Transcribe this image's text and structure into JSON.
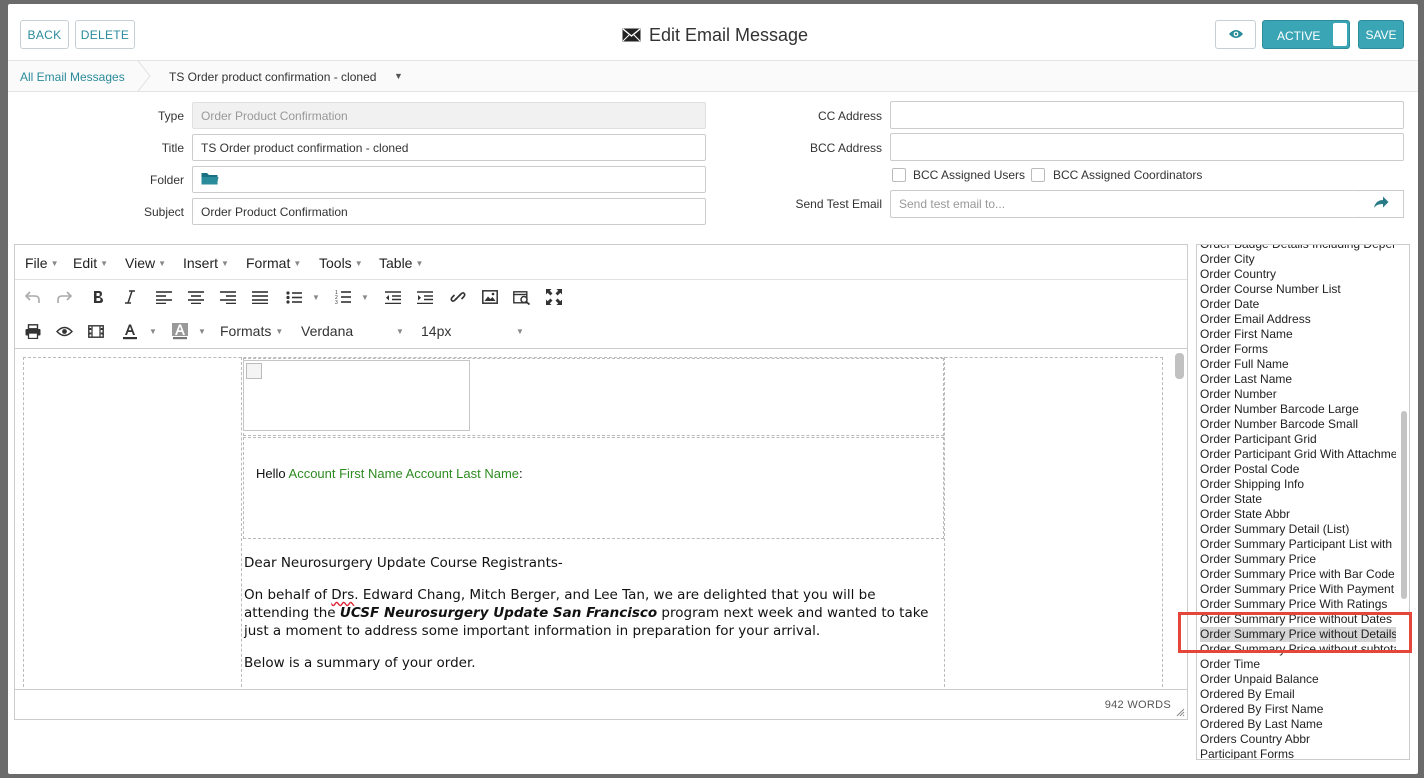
{
  "header": {
    "back_label": "BACK",
    "delete_label": "DELETE",
    "title": "Edit Email Message",
    "active_label": "ACTIVE",
    "save_label": "SAVE"
  },
  "breadcrumb": {
    "root": "All Email Messages",
    "current": "TS Order product confirmation - cloned"
  },
  "form": {
    "type_label": "Type",
    "type_value": "Order Product Confirmation",
    "title_label": "Title",
    "title_value": "TS Order product confirmation - cloned",
    "folder_label": "Folder",
    "subject_label": "Subject",
    "subject_value": "Order Product Confirmation",
    "cc_label": "CC Address",
    "cc_value": "",
    "bcc_label": "BCC Address",
    "bcc_value": "",
    "bcc_assigned_users": "BCC Assigned Users",
    "bcc_assigned_coordinators": "BCC Assigned Coordinators",
    "send_test_label": "Send Test Email",
    "send_test_placeholder": "Send test email to..."
  },
  "editor": {
    "menus": [
      "File",
      "Edit",
      "View",
      "Insert",
      "Format",
      "Tools",
      "Table"
    ],
    "formats_label": "Formats",
    "font_family": "Verdana",
    "font_size": "14px",
    "word_count": "942 WORDS",
    "content": {
      "hello": "Hello",
      "hello_tokens": "Account First Name Account Last Name",
      "hello_colon": ":",
      "greeting": "Dear Neurosurgery Update Course Registrants-",
      "para1_a": "On behalf of ",
      "para1_drs": "Drs",
      "para1_b": ". Edward Chang, Mitch Berger, and Lee Tan, we are delighted that you will be attending the ",
      "para1_program": "UCSF Neurosurgery Update San Francisco",
      "para1_c": " program next week and wanted to take just a moment to address some important information in preparation for your arrival.",
      "para2": "Below is a summary of your order."
    }
  },
  "token_list": {
    "items": [
      "Order Badge Details Including Dependents",
      "Order City",
      "Order Country",
      "Order Course Number List",
      "Order Date",
      "Order Email Address",
      "Order First Name",
      "Order Forms",
      "Order Full Name",
      "Order Last Name",
      "Order Number",
      "Order Number Barcode Large",
      "Order Number Barcode Small",
      "Order Participant Grid",
      "Order Participant Grid With Attachments",
      "Order Postal Code",
      "Order Shipping Info",
      "Order State",
      "Order State Abbr",
      "Order Summary Detail (List)",
      "Order Summary Participant List with",
      "Order Summary Price",
      "Order Summary Price with Bar Code",
      "Order Summary Price With Payment",
      "Order Summary Price With Ratings",
      "Order Summary Price without Dates",
      "Order Summary Price without Details",
      "Order Summary Price without subtotals",
      "Order Time",
      "Order Unpaid Balance",
      "Ordered By Email",
      "Ordered By First Name",
      "Ordered By Last Name",
      "Orders Country Abbr",
      "Participant Forms"
    ],
    "selected": "Order Summary Price without Details"
  },
  "colors": {
    "accent": "#3aa5b4",
    "link": "#2a8b9a",
    "token_green": "#2e8b22",
    "highlight_red": "#e5463a"
  }
}
